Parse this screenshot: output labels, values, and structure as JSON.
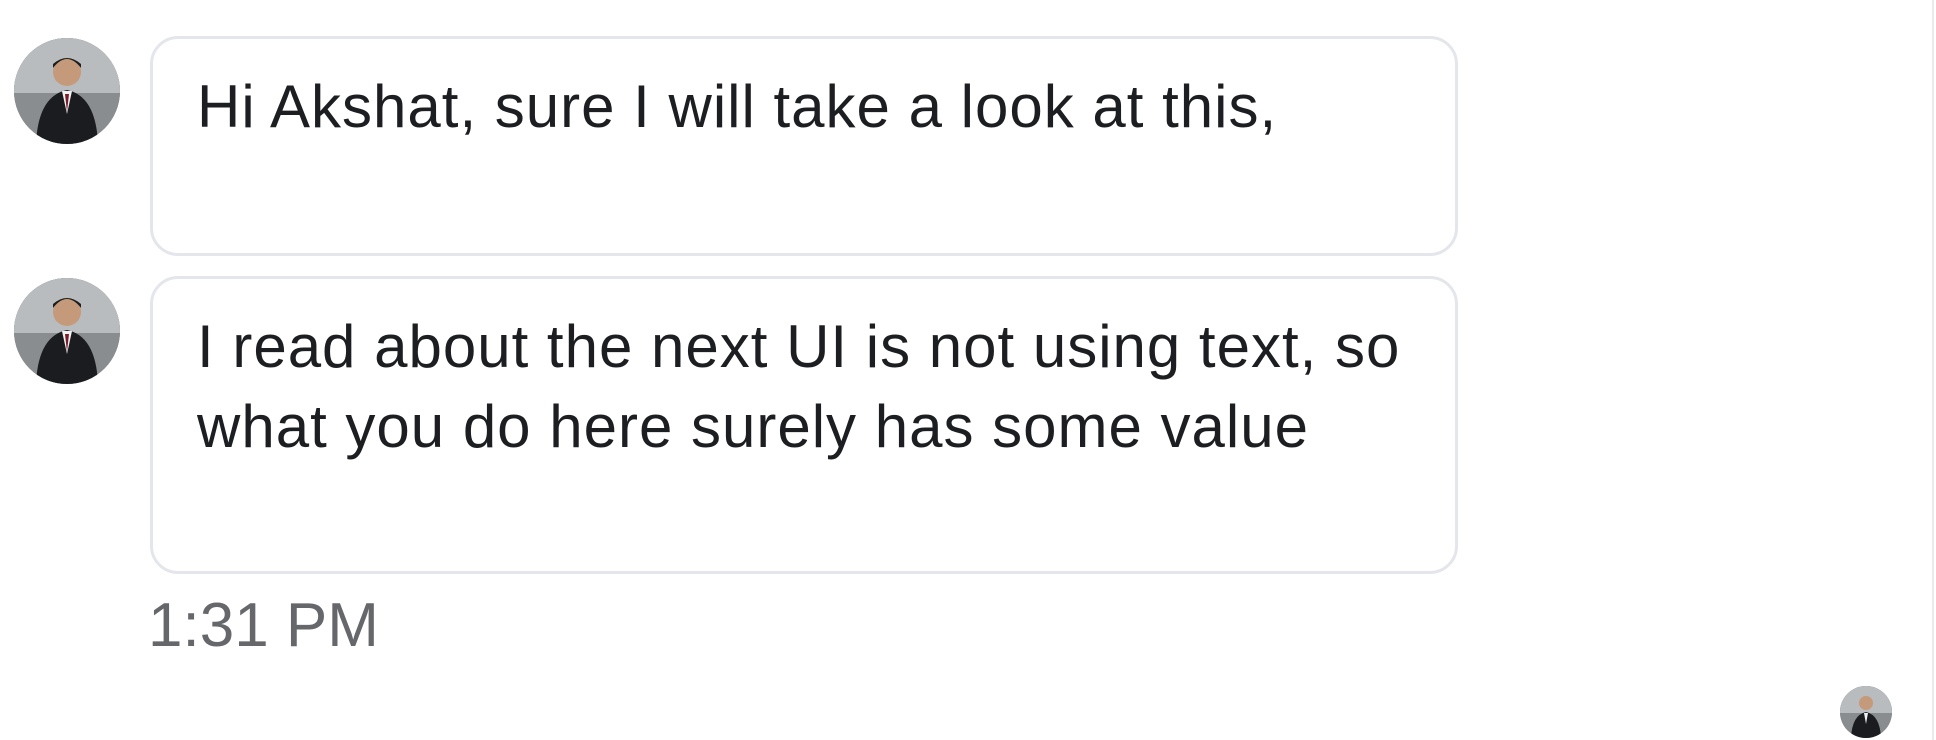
{
  "messages": [
    {
      "text": "Hi Akshat, sure I will take a look at this,"
    },
    {
      "text": "I read about the next UI is not using text, so what you do here surely has some value"
    }
  ],
  "timestamp": "1:31 PM",
  "icons": {
    "avatar": "user-avatar-photo",
    "read_receipt": "read-receipt-avatar"
  },
  "colors": {
    "bubble_border": "#e4e6eb",
    "text": "#1c1e21",
    "timestamp": "#65676b"
  }
}
